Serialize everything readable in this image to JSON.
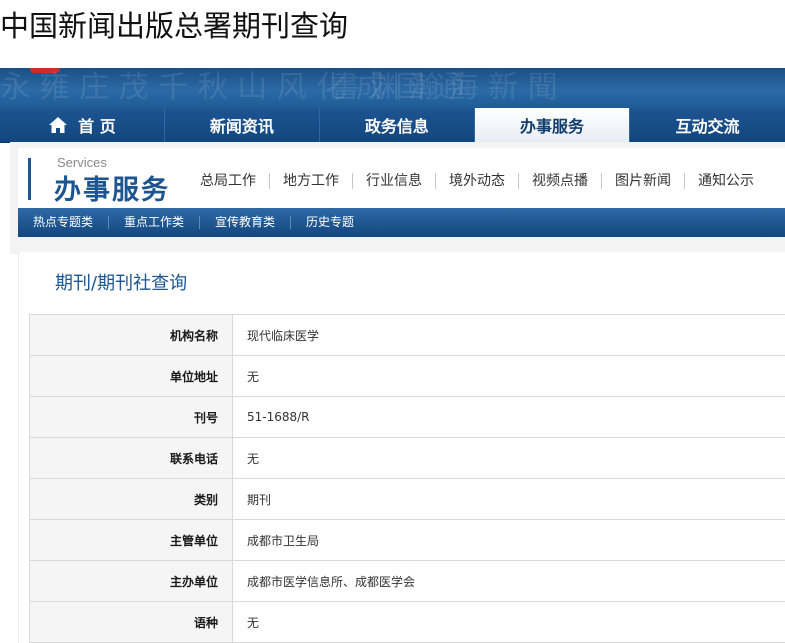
{
  "page_title": "中国新闻出版总署期刊查询",
  "nav": {
    "items": [
      {
        "label": "首 页",
        "icon": "home-icon"
      },
      {
        "label": "新闻资讯"
      },
      {
        "label": "政务信息"
      },
      {
        "label": "办事服务",
        "active": true
      },
      {
        "label": "互动交流"
      }
    ]
  },
  "section": {
    "en": "Services",
    "cn": "办事服务",
    "sub_nav": [
      "总局工作",
      "地方工作",
      "行业信息",
      "境外动态",
      "视频点播",
      "图片新闻",
      "通知公示"
    ],
    "topics": [
      "热点专题类",
      "重点工作类",
      "宣传教育类",
      "历史专题"
    ]
  },
  "query": {
    "title": "期刊/期刊社查询",
    "rows": [
      {
        "label": "机构名称",
        "value": "现代临床医学"
      },
      {
        "label": "单位地址",
        "value": "无"
      },
      {
        "label": "刊号",
        "value": "51-1688/R"
      },
      {
        "label": "联系电话",
        "value": "无"
      },
      {
        "label": "类别",
        "value": "期刊"
      },
      {
        "label": "主管单位",
        "value": "成都市卫生局"
      },
      {
        "label": "主办单位",
        "value": "成都市医学信息所、成都医学会"
      },
      {
        "label": "语种",
        "value": "无"
      }
    ]
  },
  "colors": {
    "brand_blue": "#1d5591",
    "nav_blue": "#13467f"
  }
}
